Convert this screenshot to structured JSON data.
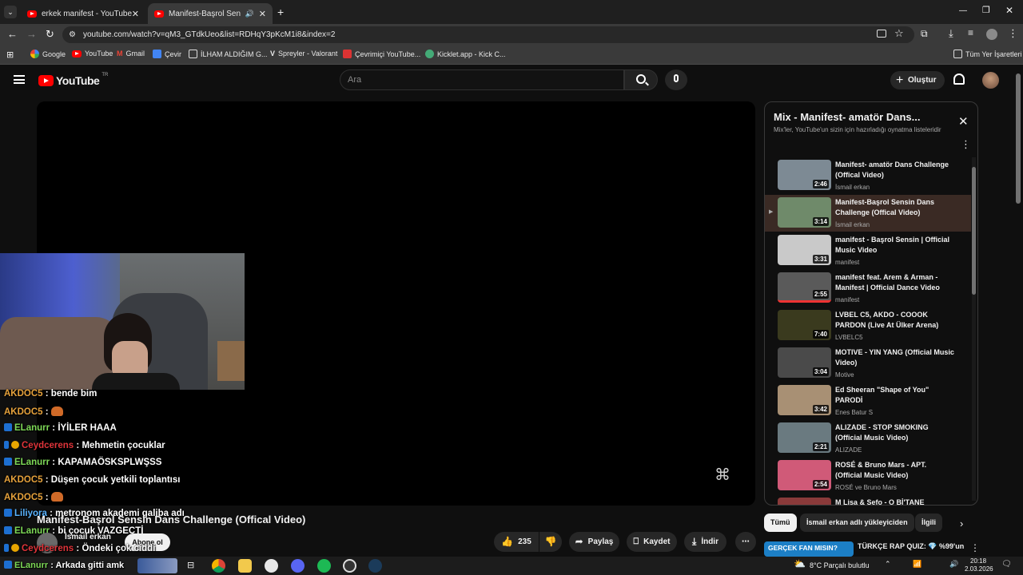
{
  "browser": {
    "tabs": [
      {
        "title": "erkek manifest - YouTube",
        "active": false
      },
      {
        "title": "Manifest-Başrol Sensin Dan",
        "active": true
      }
    ],
    "url": "youtube.com/watch?v=qM3_GTdkUeo&list=RDHqY3pKcM1i8&index=2",
    "bookmarks": [
      "Google",
      "YouTube",
      "Gmail",
      "Çevir",
      "İLHAM ALDIĞIM G...",
      "Spreyler - Valorant",
      "Çevrimiçi YouTube...",
      "Kicklet.app - Kick C..."
    ],
    "all_bookmarks": "Tüm Yer İşaretleri"
  },
  "youtube": {
    "logo_text": "YouTube",
    "region": "TR",
    "search_placeholder": "Ara",
    "create_label": "Oluştur"
  },
  "video": {
    "title": "Manifest-Başrol Sensin Dans Challenge (Offical Video)",
    "channel": "İsmail erkan",
    "subscribe_label": "Abone ol",
    "likes": "235",
    "share_label": "Paylaş",
    "save_label": "Kaydet",
    "download_label": "İndir"
  },
  "playlist": {
    "title": "Mix - Manifest- amatör Dans...",
    "subtitle": "Mix'ler, YouTube'un sizin için hazırladığı oynatma listeleridir",
    "items": [
      {
        "title": "Manifest- amatör Dans Challenge (Offical Video)",
        "channel": "İsmail erkan",
        "duration": "2:46",
        "color": "#7d8a94"
      },
      {
        "title": "Manifest-Başrol Sensin Dans Challenge (Offical Video)",
        "channel": "İsmail erkan",
        "duration": "3:14",
        "color": "#6f8a6a"
      },
      {
        "title": "manifest - Başrol Sensin | Official Music Video",
        "channel": "manifest",
        "duration": "3:31",
        "color": "#c9c9c9"
      },
      {
        "title": "manifest feat. Arem & Arman - Manifest | Official Dance Video",
        "channel": "manifest",
        "duration": "2:55",
        "color": "#5a5a5a"
      },
      {
        "title": "LVBEL C5, AKDO - COOOK PARDON (Live At Ülker Arena)",
        "channel": "LVBELC5",
        "duration": "7:40",
        "color": "#3a3a1e"
      },
      {
        "title": "MOTIVE - YIN YANG (Official Music Video)",
        "channel": "Motive",
        "duration": "3:04",
        "color": "#4a4a4a"
      },
      {
        "title": "Ed Sheeran \"Shape of You\" PARODİ",
        "channel": "Enes Batur S",
        "duration": "3:42",
        "color": "#a89074"
      },
      {
        "title": "ALIZADE - STOP SMOKING (Official Music Video)",
        "channel": "ALIZADE",
        "duration": "2:21",
        "color": "#6a7a80"
      },
      {
        "title": "ROSÉ & Bruno Mars - APT. (Official Music Video)",
        "channel": "ROSÉ ve Bruno Mars",
        "duration": "2:54",
        "color": "#d05a78"
      },
      {
        "title": "M Lisa & Sefo - O Bİ'TANE",
        "channel": "",
        "duration": "",
        "color": "#8a3a3a"
      }
    ]
  },
  "chips": [
    "Tümü",
    "İsmail erkan adlı yükleyiciden",
    "İlgili"
  ],
  "recommendation": {
    "thumb_text": "GERÇEK FAN MISIN?",
    "title": "TÜRKÇE RAP QUIZ: 💎 %99'un"
  },
  "chat": [
    {
      "user": "AKDOC5",
      "user_color": "#e6a23c",
      "text": ": bende bim",
      "badge": ""
    },
    {
      "user": "AKDOC5",
      "user_color": "#e6a23c",
      "text": ":",
      "badge": "",
      "emote": true
    },
    {
      "user": "ELanurr",
      "user_color": "#7ed957",
      "text": ": İYİLER HAAA",
      "badge": "blue"
    },
    {
      "user": "Ceydcerens",
      "user_color": "#e0343a",
      "text": ": Mehmetin çocuklar",
      "badge": "both"
    },
    {
      "user": "ELanurr",
      "user_color": "#7ed957",
      "text": ": KAPAMAÖSKSPLWŞSS",
      "badge": "blue"
    },
    {
      "user": "AKDOC5",
      "user_color": "#e6a23c",
      "text": ": Düşen çocuk yetkili toplantısı",
      "badge": ""
    },
    {
      "user": "AKDOC5",
      "user_color": "#e6a23c",
      "text": ":",
      "badge": "",
      "emote": true
    },
    {
      "user": "Liliyora",
      "user_color": "#5ab4ff",
      "text": ": metronom akademi galiba adı",
      "badge": "blue"
    },
    {
      "user": "ELanurr",
      "user_color": "#7ed957",
      "text": ": bi çocuk VAZGECTİ",
      "badge": "blue"
    },
    {
      "user": "Ceydcerens",
      "user_color": "#e0343a",
      "text": ": Öndeki çok ciddi",
      "badge": "both"
    },
    {
      "user": "ELanurr",
      "user_color": "#7ed957",
      "text": ": Arkada gitti amk",
      "badge": "blue"
    }
  ],
  "taskbar": {
    "weather": "8°C  Parçalı bulutlu",
    "time": "20:18",
    "date": "2.03.2026"
  }
}
